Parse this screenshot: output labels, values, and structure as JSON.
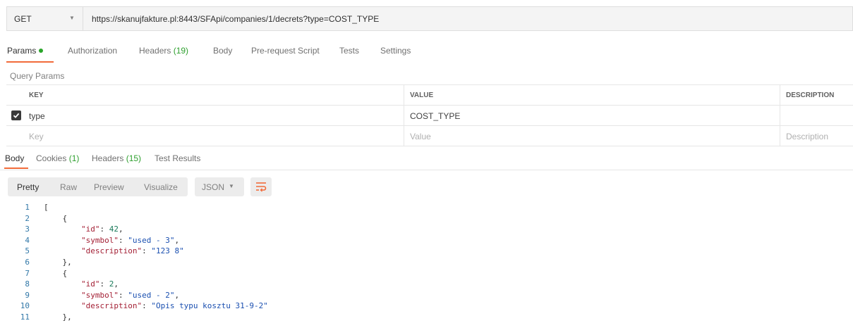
{
  "request": {
    "method": "GET",
    "url": "https://skanujfakture.pl:8443/SFApi/companies/1/decrets?type=COST_TYPE"
  },
  "request_tabs": [
    {
      "label": "Params",
      "active": true
    },
    {
      "label": "Authorization"
    },
    {
      "label": "Headers",
      "count": "(19)"
    },
    {
      "label": "Body"
    },
    {
      "label": "Pre-request Script"
    },
    {
      "label": "Tests"
    },
    {
      "label": "Settings"
    }
  ],
  "query_params": {
    "title": "Query Params",
    "headers": {
      "key": "KEY",
      "value": "VALUE",
      "description": "DESCRIPTION"
    },
    "rows": [
      {
        "checked": true,
        "key": "type",
        "value": "COST_TYPE",
        "description": ""
      }
    ],
    "placeholders": {
      "key": "Key",
      "value": "Value",
      "description": "Description"
    }
  },
  "response_tabs": [
    {
      "label": "Body",
      "active": true
    },
    {
      "label": "Cookies",
      "count": "(1)"
    },
    {
      "label": "Headers",
      "count": "(15)"
    },
    {
      "label": "Test Results"
    }
  ],
  "format_modes": [
    "Pretty",
    "Raw",
    "Preview",
    "Visualize"
  ],
  "active_format": "Pretty",
  "language": "JSON",
  "icons": {
    "wrap": "wrap-lines-icon",
    "dropdown": "chevron-down-icon",
    "check": "checkmark-icon"
  },
  "colors": {
    "accent": "#f26b3a",
    "success": "#2aa52a",
    "line_numbers": "#3278a8",
    "json_key": "#a31f34",
    "json_string": "#1a4fb0",
    "json_number": "#1a7a5a"
  },
  "code_lines": [
    {
      "n": "1",
      "t": "["
    },
    {
      "n": "2",
      "t": "    {"
    },
    {
      "n": "3",
      "t": "        \"id\": 42,"
    },
    {
      "n": "4",
      "t": "        \"symbol\": \"used - 3\","
    },
    {
      "n": "5",
      "t": "        \"description\": \"123 8\""
    },
    {
      "n": "6",
      "t": "    },"
    },
    {
      "n": "7",
      "t": "    {"
    },
    {
      "n": "8",
      "t": "        \"id\": 2,"
    },
    {
      "n": "9",
      "t": "        \"symbol\": \"used - 2\","
    },
    {
      "n": "10",
      "t": "        \"description\": \"Opis typu kosztu 31-9-2\""
    },
    {
      "n": "11",
      "t": "    },"
    }
  ]
}
